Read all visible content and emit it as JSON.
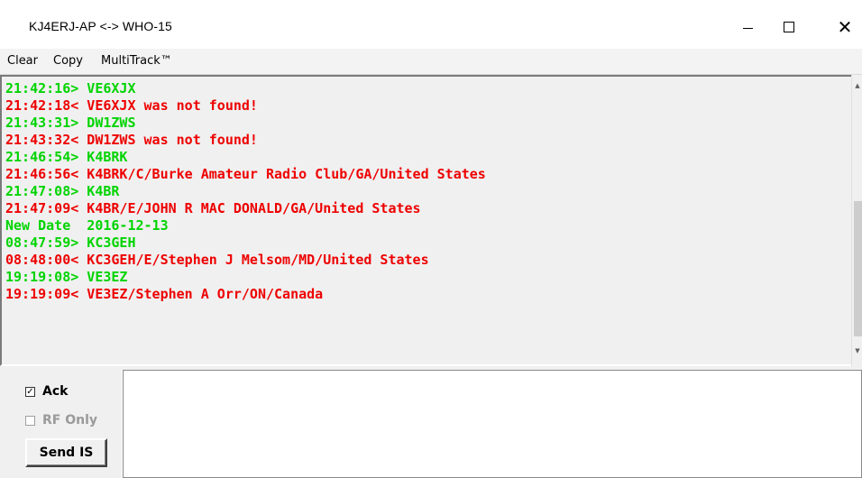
{
  "window": {
    "title": "KJ4ERJ-AP <-> WHO-15"
  },
  "menu": {
    "items": [
      "Clear",
      "Copy",
      "MultiTrack™"
    ]
  },
  "colors": {
    "sent": "#00d400",
    "received": "#ee0000"
  },
  "log": {
    "lines": [
      {
        "text": "21:42:16> VE6XJX",
        "kind": "sent"
      },
      {
        "text": "21:42:18< VE6XJX was not found!",
        "kind": "received"
      },
      {
        "text": "21:43:31> DW1ZWS",
        "kind": "sent"
      },
      {
        "text": "21:43:32< DW1ZWS was not found!",
        "kind": "received"
      },
      {
        "text": "21:46:54> K4BRK",
        "kind": "sent"
      },
      {
        "text": "21:46:56< K4BRK/C/Burke Amateur Radio Club/GA/United States",
        "kind": "received"
      },
      {
        "text": "21:47:08> K4BR",
        "kind": "sent"
      },
      {
        "text": "21:47:09< K4BR/E/JOHN R MAC DONALD/GA/United States",
        "kind": "received"
      },
      {
        "text": "New Date  2016-12-13",
        "kind": "sent"
      },
      {
        "text": "08:47:59> KC3GEH",
        "kind": "sent"
      },
      {
        "text": "08:48:00< KC3GEH/E/Stephen J Melsom/MD/United States",
        "kind": "received"
      },
      {
        "text": "19:19:08> VE3EZ",
        "kind": "sent"
      },
      {
        "text": "19:19:09< VE3EZ/Stephen A Orr/ON/Canada",
        "kind": "received"
      }
    ]
  },
  "controls": {
    "ack": {
      "label": "Ack",
      "checked": true,
      "check_glyph": "✓"
    },
    "rf_only": {
      "label": "RF Only",
      "checked": false,
      "enabled": false
    },
    "send_button": "Send IS"
  },
  "message_input": {
    "value": ""
  }
}
